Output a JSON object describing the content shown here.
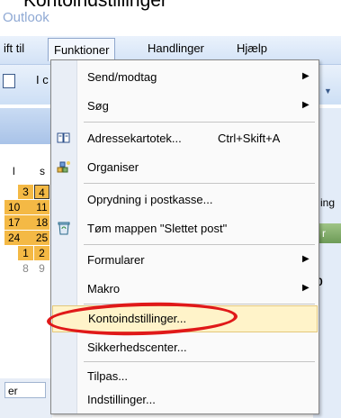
{
  "top_title": "Kontoindstillinger",
  "app_title": "Outlook",
  "menubar": {
    "items": [
      {
        "label": "ift til"
      },
      {
        "label": "Funktioner"
      },
      {
        "label": "Handlinger"
      },
      {
        "label": "Hjælp"
      }
    ]
  },
  "toolbar": {
    "text": "I c"
  },
  "calendar": {
    "header": [
      "l",
      "s"
    ],
    "rows": [
      [
        "3",
        "4"
      ],
      [
        "10",
        "11"
      ],
      [
        "17",
        "18"
      ],
      [
        "24",
        "25"
      ],
      [
        "1",
        "2"
      ],
      [
        "8",
        "9"
      ]
    ]
  },
  "right_strip": {
    "label_top": "ing",
    "tab_label": "r",
    "label_mid": "0"
  },
  "bottom_left": {
    "input_value": "er"
  },
  "menu": {
    "items": [
      {
        "label": "Send/modtag",
        "shortcut": "",
        "submenu": true,
        "icon": ""
      },
      {
        "label": "Søg",
        "shortcut": "",
        "submenu": true,
        "icon": ""
      },
      {
        "label": "Adressekartotek...",
        "shortcut": "Ctrl+Skift+A",
        "submenu": false,
        "icon": "address-book-icon"
      },
      {
        "label": "Organiser",
        "shortcut": "",
        "submenu": false,
        "icon": "organize-icon"
      },
      {
        "label": "Oprydning i postkasse...",
        "shortcut": "",
        "submenu": false,
        "icon": ""
      },
      {
        "label": "Tøm mappen \"Slettet post\"",
        "shortcut": "",
        "submenu": false,
        "icon": "recycle-bin-icon"
      },
      {
        "label": "Formularer",
        "shortcut": "",
        "submenu": true,
        "icon": ""
      },
      {
        "label": "Makro",
        "shortcut": "",
        "submenu": true,
        "icon": ""
      },
      {
        "label": "Kontoindstillinger...",
        "shortcut": "",
        "submenu": false,
        "icon": "",
        "highlighted": true
      },
      {
        "label": "Sikkerhedscenter...",
        "shortcut": "",
        "submenu": false,
        "icon": ""
      },
      {
        "label": "Tilpas...",
        "shortcut": "",
        "submenu": false,
        "icon": ""
      },
      {
        "label": "Indstillinger...",
        "shortcut": "",
        "submenu": false,
        "icon": ""
      }
    ]
  },
  "colors": {
    "highlight": "#fff3c9",
    "annotation": "#e01919",
    "menubar": "#d3e2f6"
  }
}
